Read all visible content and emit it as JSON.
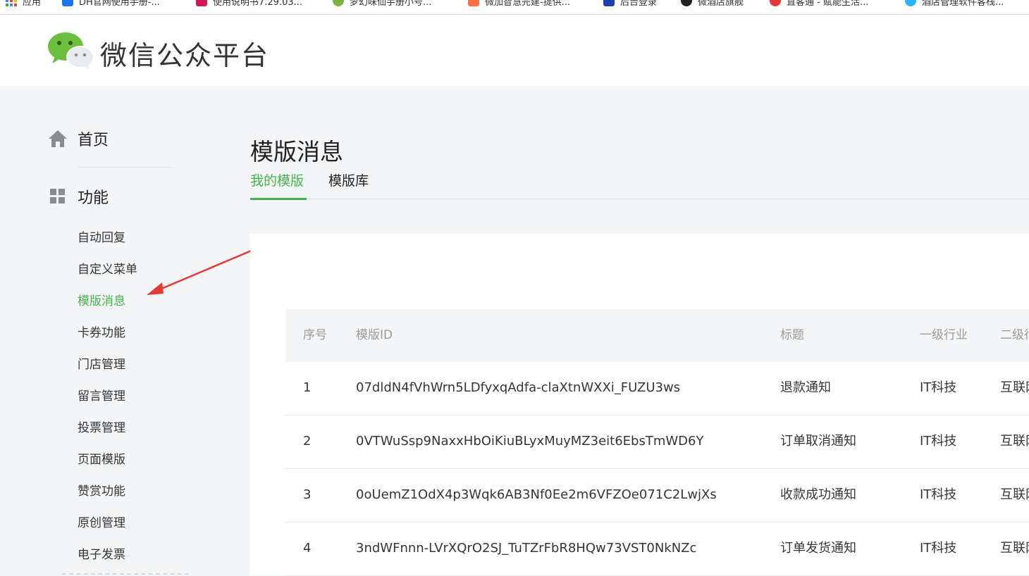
{
  "bookmarks": [
    {
      "label": "应用",
      "color": "#4285f4"
    },
    {
      "label": "DH官网使用手册-...",
      "color": "#1a73e8"
    },
    {
      "label": "使用说明书7.29.03...",
      "color": "#d4145a"
    },
    {
      "label": "梦幻味仙手册小号...",
      "color": "#7cb342"
    },
    {
      "label": "微加智慧完建-提供...",
      "color": "#ff7043"
    },
    {
      "label": "后台登录",
      "color": "#1e40af"
    },
    {
      "label": "微酒店旗舰",
      "color": "#222222"
    },
    {
      "label": "直客通 - 赋能生活...",
      "color": "#e53935"
    },
    {
      "label": "酒店管理软件客栈...",
      "color": "#29b6f6"
    }
  ],
  "header": {
    "brand": "微信公众平台"
  },
  "sidebar": {
    "home_label": "首页",
    "func_label": "功能",
    "items": [
      {
        "label": "自动回复",
        "active": false
      },
      {
        "label": "自定义菜单",
        "active": false
      },
      {
        "label": "模版消息",
        "active": true
      },
      {
        "label": "卡券功能",
        "active": false
      },
      {
        "label": "门店管理",
        "active": false
      },
      {
        "label": "留言管理",
        "active": false
      },
      {
        "label": "投票管理",
        "active": false
      },
      {
        "label": "页面模版",
        "active": false
      },
      {
        "label": "赞赏功能",
        "active": false
      },
      {
        "label": "原创管理",
        "active": false
      },
      {
        "label": "电子发票",
        "active": false
      }
    ]
  },
  "main": {
    "title": "模版消息",
    "tabs": [
      {
        "label": "我的模版",
        "active": true
      },
      {
        "label": "模版库",
        "active": false
      }
    ],
    "table": {
      "headers": {
        "no": "序号",
        "id": "模版ID",
        "title": "标题",
        "ind1": "一级行业",
        "ind2": "二级行业"
      },
      "rows": [
        {
          "no": "1",
          "id": "07dldN4fVhWrn5LDfyxqAdfa-claXtnWXXi_FUZU3ws",
          "title": "退款通知",
          "ind1": "IT科技",
          "ind2": "互联网"
        },
        {
          "no": "2",
          "id": "0VTWuSsp9NaxxHbOiKiuBLyxMuyMZ3eit6EbsTmWD6Y",
          "title": "订单取消通知",
          "ind1": "IT科技",
          "ind2": "互联网"
        },
        {
          "no": "3",
          "id": "0oUemZ1OdX4p3Wqk6AB3Nf0Ee2m6VFZOe071C2LwjXs",
          "title": "收款成功通知",
          "ind1": "IT科技",
          "ind2": "互联网"
        },
        {
          "no": "4",
          "id": "3ndWFnnn-LVrXQrO2SJ_TuTZrFbR8HQw73VST0NkNZc",
          "title": "订单发货通知",
          "ind1": "IT科技",
          "ind2": "互联网"
        }
      ]
    }
  },
  "colors": {
    "accent": "#44b549",
    "annotation_arrow": "#e53935",
    "page_bg": "#f4f5f6"
  }
}
